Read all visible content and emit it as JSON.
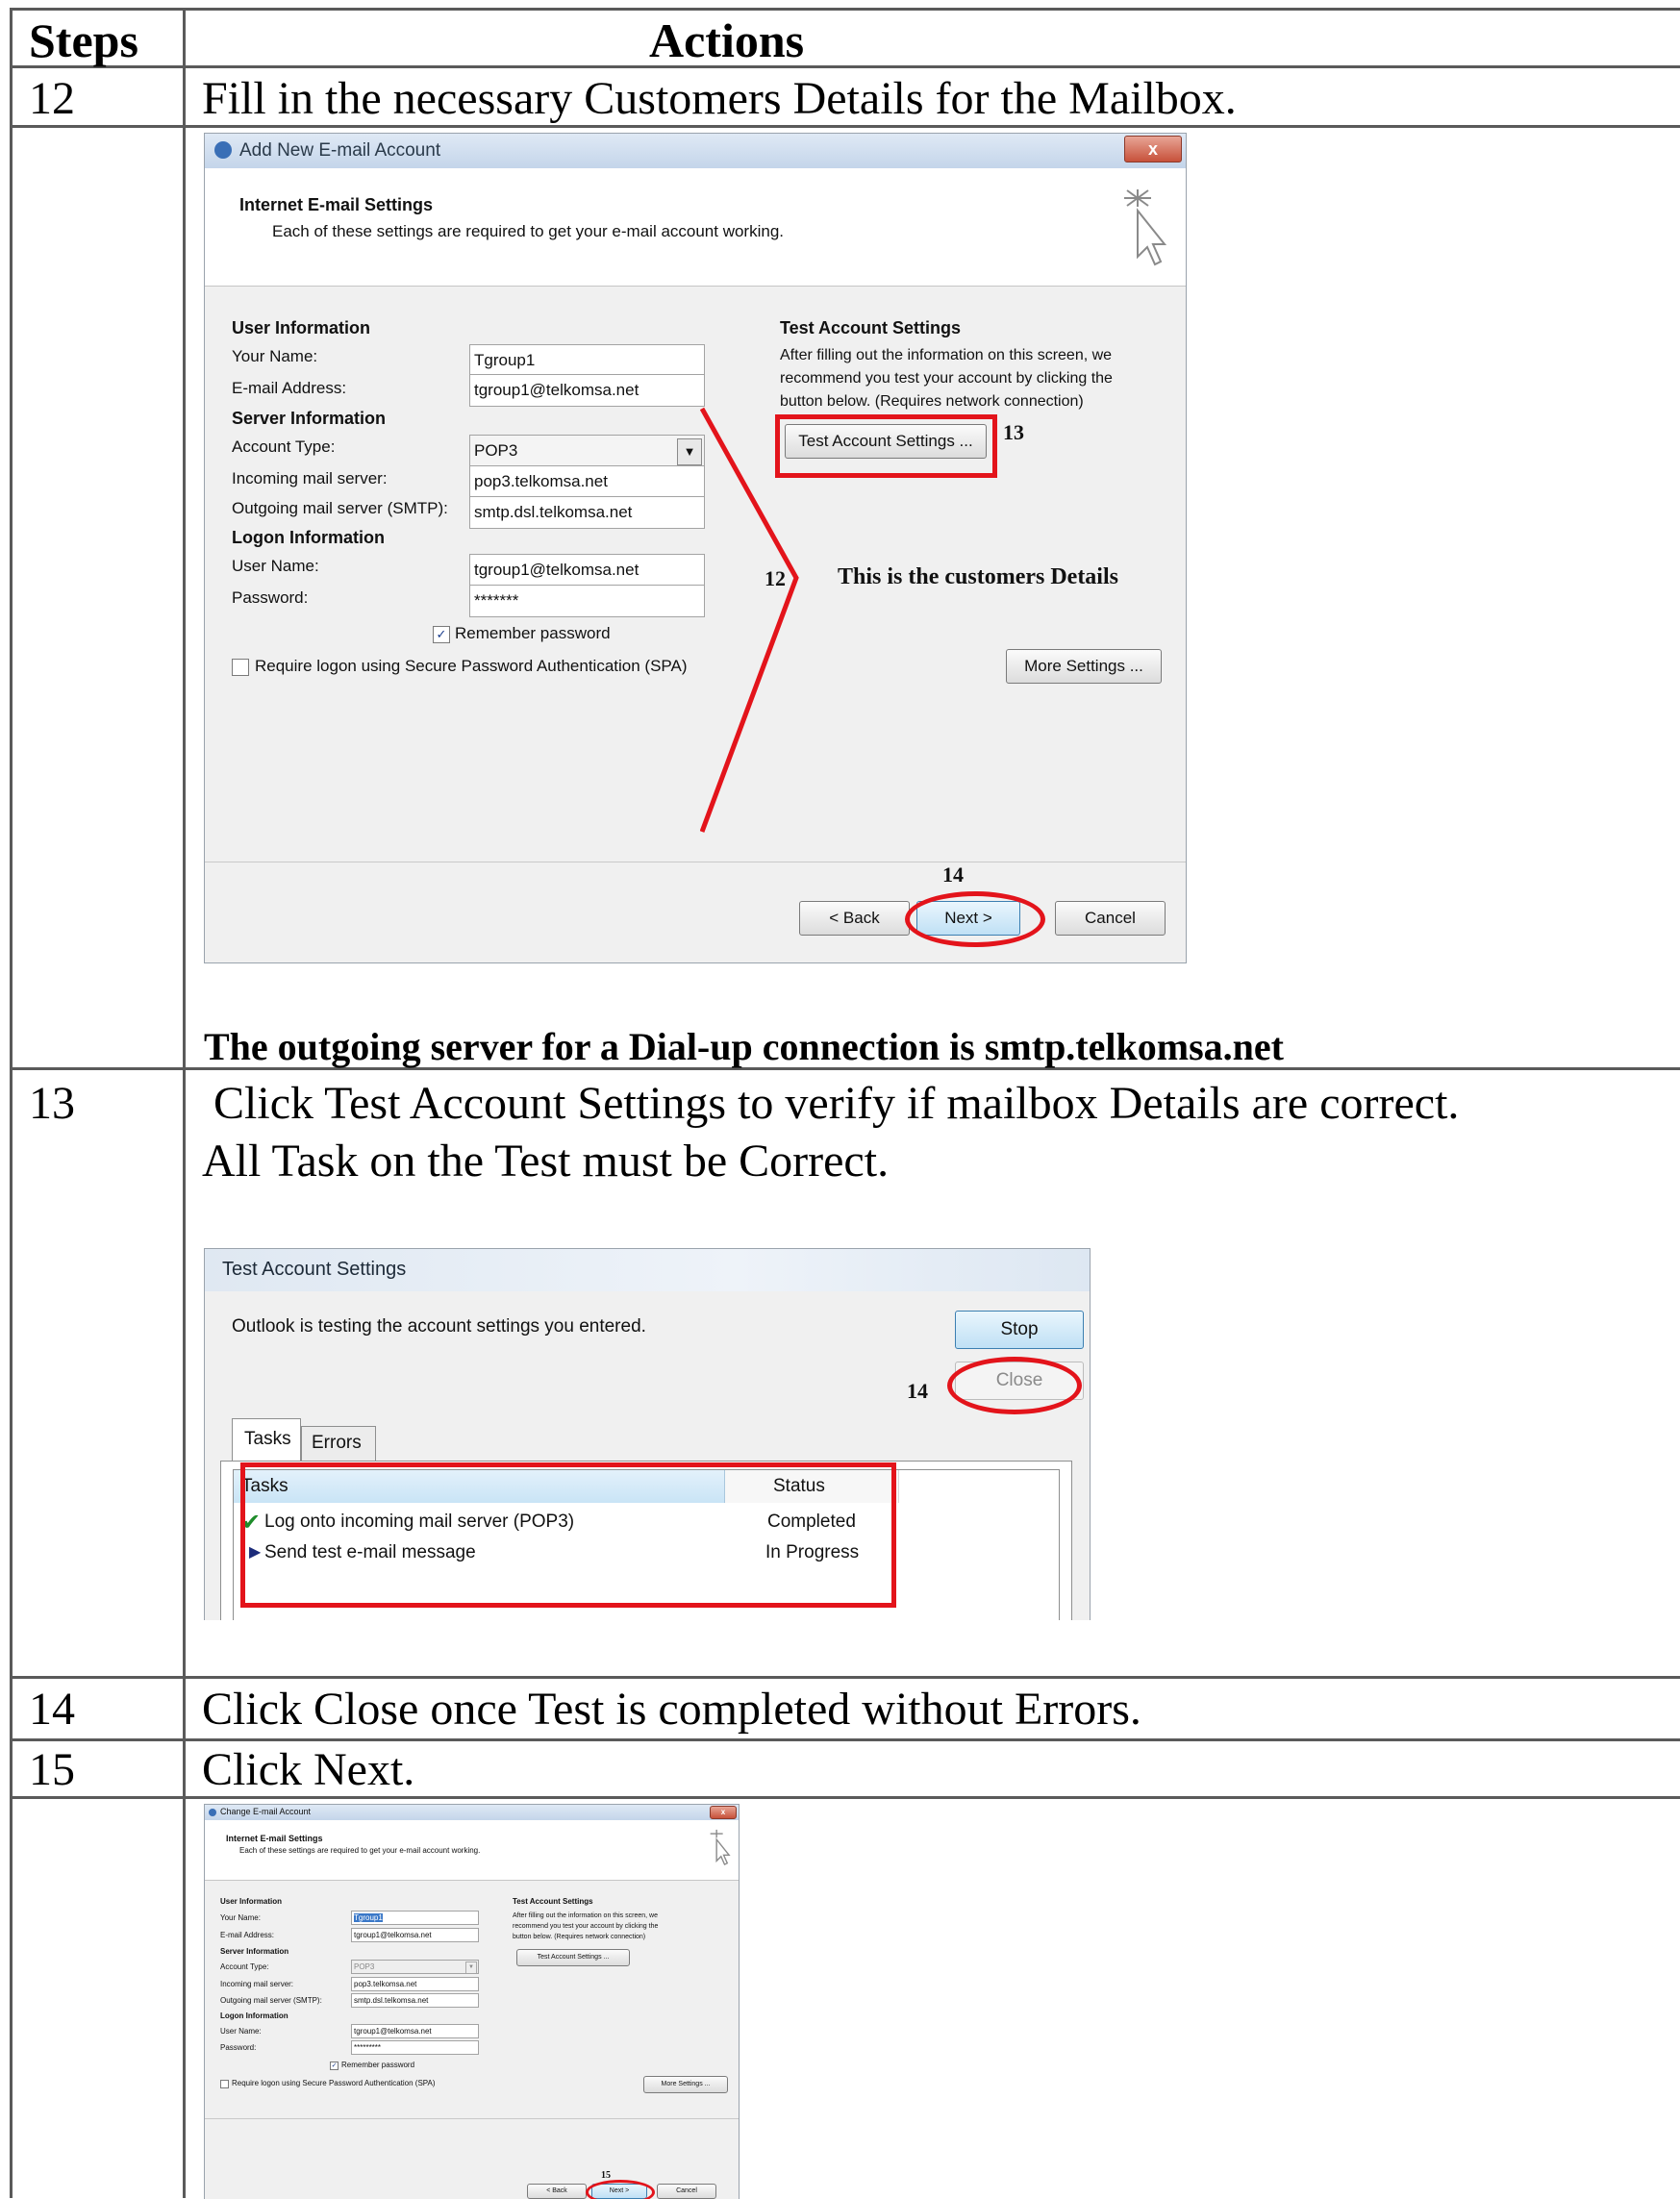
{
  "table": {
    "header_steps": "Steps",
    "header_actions": "Actions",
    "rows": [
      {
        "step": "12",
        "action": "Fill in the necessary Customers Details for the Mailbox."
      },
      {
        "step": "13",
        "action_line1": " Click Test Account Settings to verify if mailbox Details are correct.",
        "action_line2": "All Task on the Test must be Correct."
      },
      {
        "step": "14",
        "action": "Click Close once Test is completed without Errors."
      },
      {
        "step": "15",
        "action": "Click Next."
      }
    ],
    "note": "The outgoing server for a Dial-up connection is smtp.telkomsa.net"
  },
  "dialog1": {
    "title": "Add New E-mail Account",
    "close_glyph": "x",
    "header_title": "Internet E-mail Settings",
    "header_subtitle": "Each of these settings are required to get your e-mail account working.",
    "user_info_heading": "User Information",
    "your_name_label": "Your Name:",
    "your_name_value": "Tgroup1",
    "email_label": "E-mail Address:",
    "email_value": "tgroup1@telkomsa.net",
    "server_info_heading": "Server Information",
    "account_type_label": "Account Type:",
    "account_type_value": "POP3",
    "incoming_label": "Incoming mail server:",
    "incoming_value": "pop3.telkomsa.net",
    "outgoing_label": "Outgoing mail server (SMTP):",
    "outgoing_value": "smtp.dsl.telkomsa.net",
    "logon_info_heading": "Logon Information",
    "user_name_label": "User Name:",
    "user_name_value": "tgroup1@telkomsa.net",
    "password_label": "Password:",
    "password_value": "*******",
    "remember_label": "Remember password",
    "spa_label": "Require logon using Secure Password Authentication (SPA)",
    "test_heading": "Test Account Settings",
    "test_desc_1": "After filling out the information on this screen, we",
    "test_desc_2": "recommend you test your account by clicking the",
    "test_desc_3": "button below. (Requires network connection)",
    "test_button": "Test Account Settings ...",
    "more_settings_button": "More Settings ...",
    "back_button": "< Back",
    "next_button": "Next >",
    "cancel_button": "Cancel",
    "annot_13": "13",
    "annot_12": "12",
    "annot_14": "14",
    "annot_text": "This is the customers Details"
  },
  "dialog2": {
    "title": "Test Account Settings",
    "message": "Outlook is testing the account settings you entered.",
    "stop_button": "Stop",
    "close_button": "Close",
    "annot_14": "14",
    "tab_tasks": "Tasks",
    "tab_errors": "Errors",
    "col_tasks": "Tasks",
    "col_status": "Status",
    "rows": [
      {
        "task": "Log onto incoming mail server (POP3)",
        "status": "Completed",
        "icon": "check-icon"
      },
      {
        "task": "Send test e-mail message",
        "status": "In Progress",
        "icon": "arrow-right-icon"
      }
    ]
  },
  "dialog3": {
    "title": "Change E-mail Account",
    "header_title": "Internet E-mail Settings",
    "header_subtitle": "Each of these settings are required to get your e-mail account working.",
    "user_info_heading": "User Information",
    "your_name_label": "Your Name:",
    "your_name_value": "Tgroup1",
    "email_label": "E-mail Address:",
    "email_value": "tgroup1@telkomsa.net",
    "server_info_heading": "Server Information",
    "account_type_label": "Account Type:",
    "account_type_value": "POP3",
    "incoming_label": "Incoming mail server:",
    "incoming_value": "pop3.telkomsa.net",
    "outgoing_label": "Outgoing mail server (SMTP):",
    "outgoing_value": "smtp.dsl.telkomsa.net",
    "logon_info_heading": "Logon Information",
    "user_name_label": "User Name:",
    "user_name_value": "tgroup1@telkomsa.net",
    "password_label": "Password:",
    "password_value": "*********",
    "remember_label": "Remember password",
    "spa_label": "Require logon using Secure Password Authentication (SPA)",
    "test_heading": "Test Account Settings",
    "test_desc_1": "After filling out the information on this screen, we",
    "test_desc_2": "recommend you test your account by clicking the",
    "test_desc_3": "button below. (Requires network connection)",
    "test_button": "Test Account Settings ...",
    "more_settings_button": "More Settings ...",
    "back_button": "< Back",
    "next_button": "Next >",
    "cancel_button": "Cancel",
    "annot_15": "15"
  },
  "colors": {
    "annotation_red": "#e3141b",
    "grid": "#5a5a5a"
  }
}
